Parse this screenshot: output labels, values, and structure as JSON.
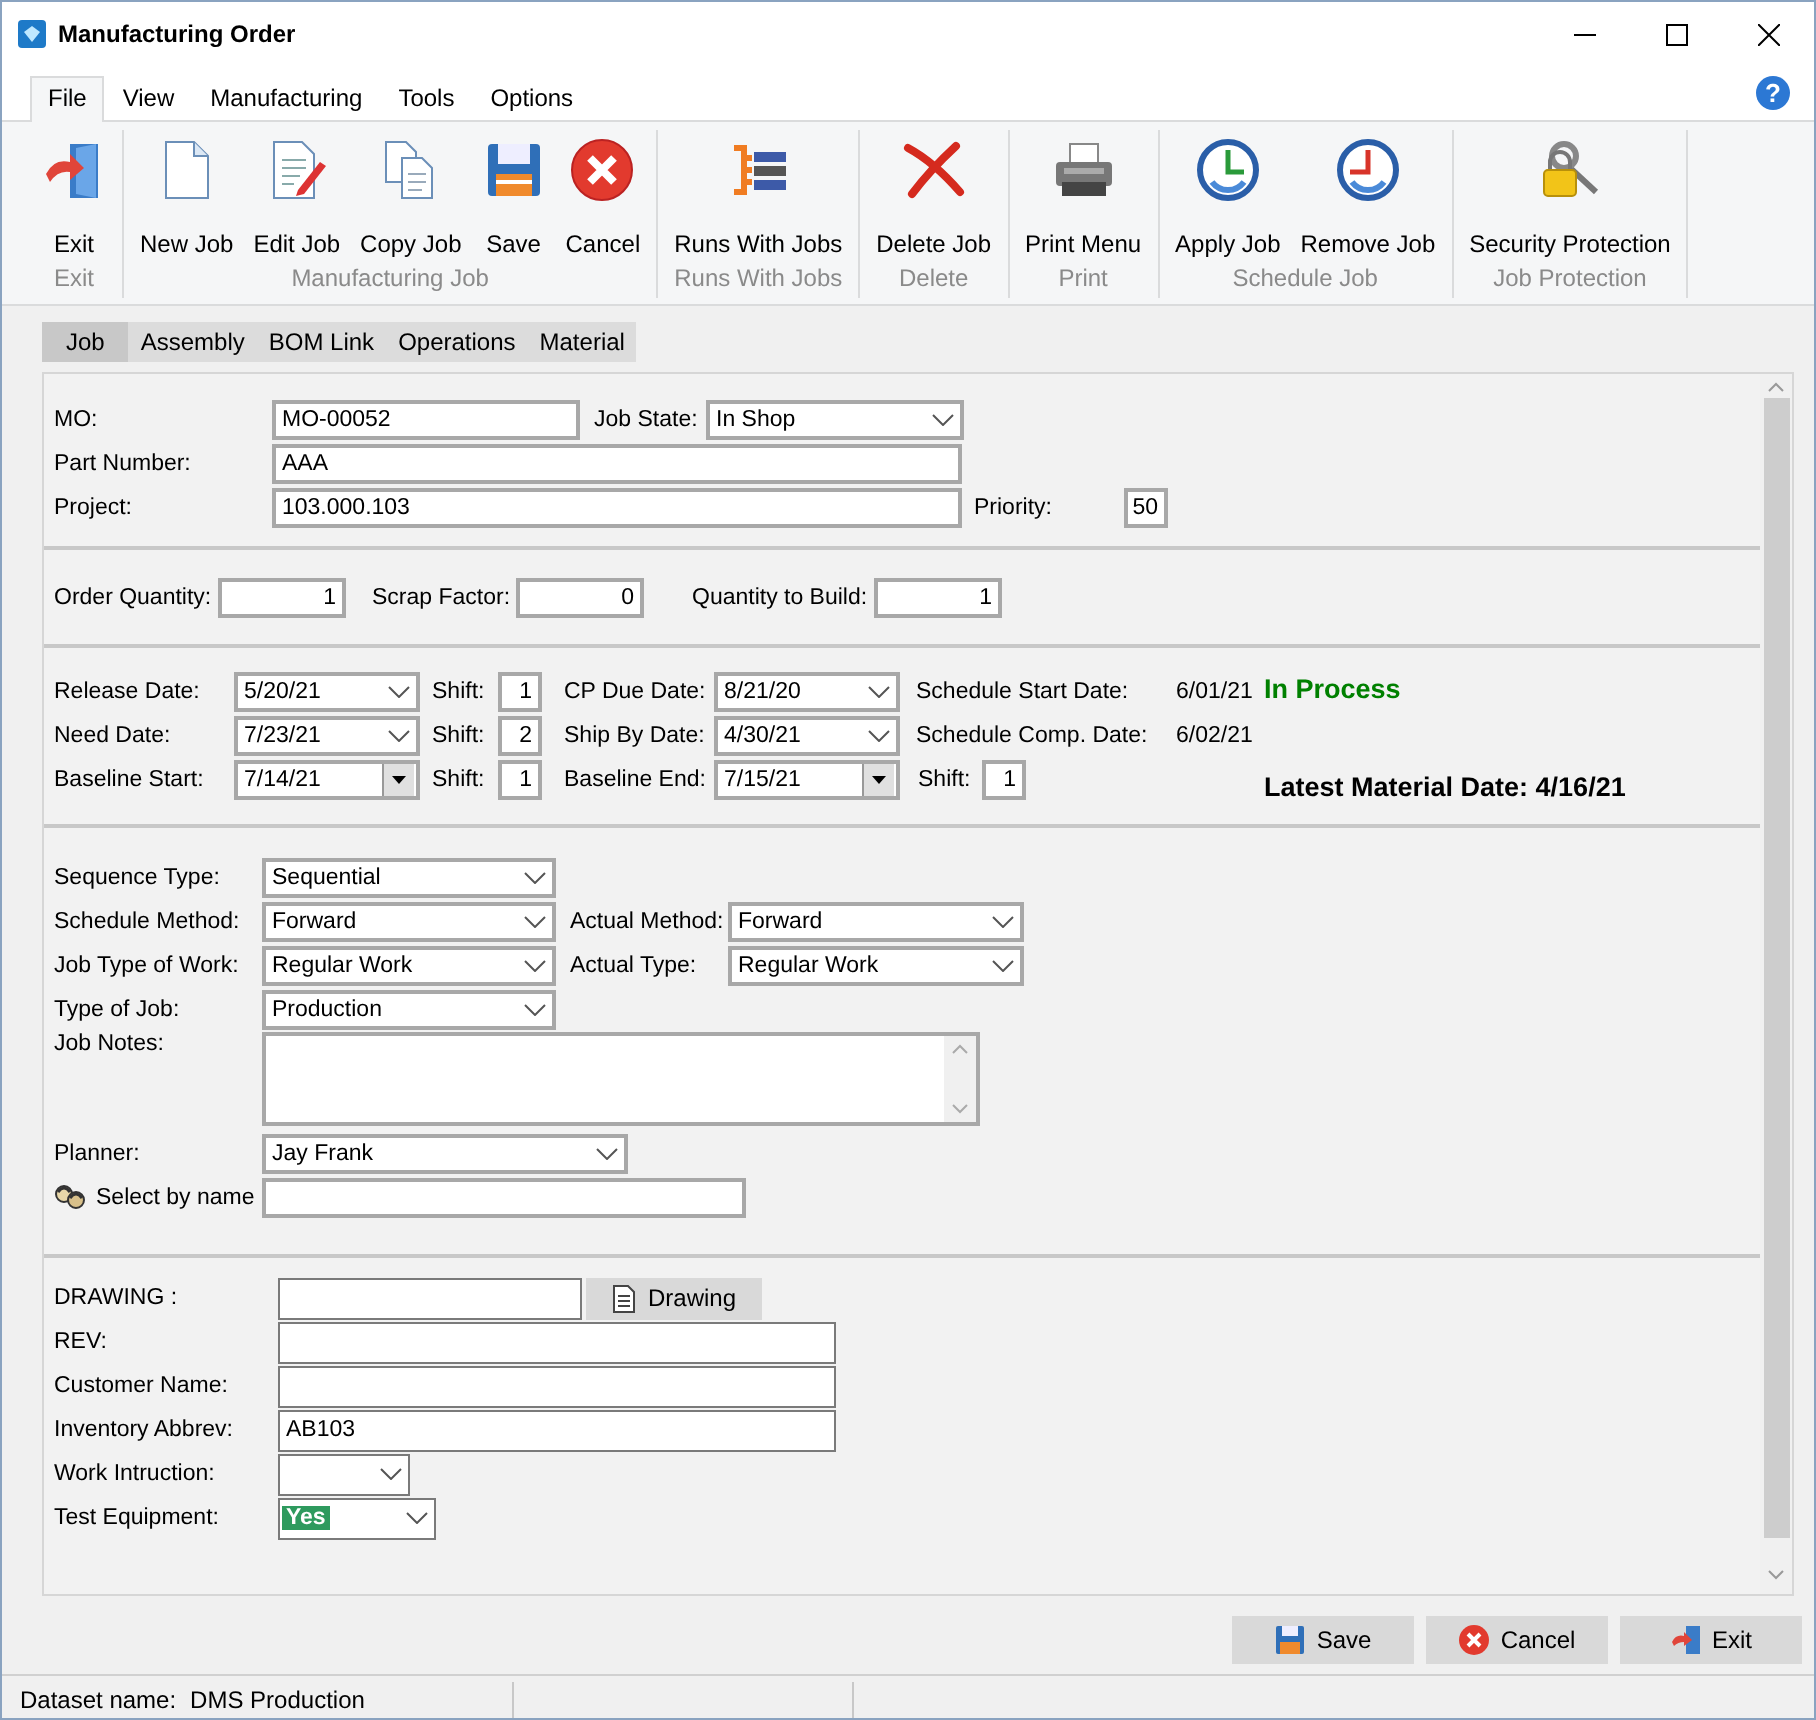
{
  "window": {
    "title": "Manufacturing Order"
  },
  "menu": [
    {
      "label": "File",
      "selected": true
    },
    {
      "label": "View",
      "selected": false
    },
    {
      "label": "Manufacturing",
      "selected": false
    },
    {
      "label": "Tools",
      "selected": false
    },
    {
      "label": "Options",
      "selected": false
    }
  ],
  "help": "?",
  "ribbon": [
    {
      "group": "Exit",
      "buttons": [
        "Exit"
      ]
    },
    {
      "group": "Manufacturing Job",
      "buttons": [
        "New Job",
        "Edit Job",
        "Copy Job",
        "Save",
        "Cancel"
      ]
    },
    {
      "group": "Runs With Jobs",
      "buttons": [
        "Runs With Jobs"
      ]
    },
    {
      "group": "Delete",
      "buttons": [
        "Delete Job"
      ]
    },
    {
      "group": "Print",
      "buttons": [
        "Print Menu"
      ]
    },
    {
      "group": "Schedule Job",
      "buttons": [
        "Apply Job",
        "Remove Job"
      ]
    },
    {
      "group": "Job Protection",
      "buttons": [
        "Security Protection"
      ]
    }
  ],
  "tabs": [
    {
      "label": "Job",
      "selected": true
    },
    {
      "label": "Assembly",
      "selected": false
    },
    {
      "label": "BOM Link",
      "selected": false
    },
    {
      "label": "Operations",
      "selected": false
    },
    {
      "label": "Material",
      "selected": false
    }
  ],
  "sections": [
    {
      "rows": [
        [
          {
            "label": "MO:",
            "kind": "text",
            "value": "MO-00052"
          },
          {
            "label": "Job State:",
            "kind": "combo",
            "value": "In Shop"
          }
        ],
        [
          {
            "label": "Part Number:",
            "kind": "text",
            "value": "AAA"
          }
        ],
        [
          {
            "label": "Project:",
            "kind": "text",
            "value": "103.000.103"
          },
          {
            "label": "Priority:",
            "kind": "number",
            "value": "50"
          }
        ]
      ]
    },
    {
      "rows": [
        [
          {
            "label": "Order Quantity:",
            "kind": "number",
            "value": "1"
          },
          {
            "label": "Scrap Factor:",
            "kind": "number",
            "value": "0"
          },
          {
            "label": "Quantity to Build:",
            "kind": "number",
            "value": "1"
          }
        ]
      ]
    },
    {
      "rows": [
        [
          {
            "label": "Release Date:",
            "kind": "combo",
            "value": "5/20/21"
          },
          {
            "label": "Shift:",
            "kind": "number",
            "value": "1"
          },
          {
            "label": "CP Due Date:",
            "kind": "combo",
            "value": "8/21/20"
          },
          {
            "label": "Schedule Start Date:",
            "kind": "readout",
            "value": "6/01/21"
          }
        ],
        [
          {
            "label": "Need Date:",
            "kind": "combo",
            "value": "7/23/21"
          },
          {
            "label": "Shift:",
            "kind": "number",
            "value": "2"
          },
          {
            "label": "Ship By Date:",
            "kind": "combo",
            "value": "4/30/21"
          },
          {
            "label": "Schedule Comp. Date:",
            "kind": "readout",
            "value": "6/02/21"
          }
        ],
        [
          {
            "label": "Baseline Start:",
            "kind": "picker",
            "value": "7/14/21"
          },
          {
            "label": "Shift:",
            "kind": "number",
            "value": "1"
          },
          {
            "label": "Baseline End:",
            "kind": "picker",
            "value": "7/15/21"
          },
          {
            "label": "Shift:",
            "kind": "number",
            "value": "1"
          }
        ]
      ],
      "notes": [
        {
          "text": "In Process",
          "color": "#008000"
        },
        {
          "text": "Latest Material Date: 4/16/21",
          "color": "#000000"
        }
      ]
    },
    {
      "rows": [
        [
          {
            "label": "Sequence Type:",
            "kind": "combo",
            "value": "Sequential"
          }
        ],
        [
          {
            "label": "Schedule Method:",
            "kind": "combo",
            "value": "Forward"
          },
          {
            "label": "Actual Method:",
            "kind": "combo",
            "value": "Forward"
          }
        ],
        [
          {
            "label": "Job Type of Work:",
            "kind": "combo",
            "value": "Regular Work"
          },
          {
            "label": "Actual Type:",
            "kind": "combo",
            "value": "Regular Work"
          }
        ],
        [
          {
            "label": "Type of Job:",
            "kind": "combo",
            "value": "Production"
          }
        ],
        [
          {
            "label": "Job Notes:",
            "kind": "memo"
          }
        ],
        [
          {
            "label": "Planner:",
            "kind": "combo",
            "value": "Jay Frank"
          }
        ],
        [
          {
            "label": "Select by name",
            "kind": "name-search"
          }
        ]
      ]
    },
    {
      "rows": [
        [
          {
            "label": "DRAWING :",
            "kind": "text"
          },
          {
            "label": "Drawing",
            "kind": "button"
          }
        ],
        [
          {
            "label": "REV:",
            "kind": "text"
          }
        ],
        [
          {
            "label": "Customer Name:",
            "kind": "text"
          }
        ],
        [
          {
            "label": "Inventory Abbrev:",
            "kind": "text",
            "value": "AB103"
          }
        ],
        [
          {
            "label": "Work Intruction:",
            "kind": "combo"
          }
        ],
        [
          {
            "label": "Test Equipment:",
            "kind": "focused-combo",
            "value": "Yes"
          }
        ]
      ]
    }
  ],
  "footer_buttons": [
    "Save",
    "Cancel",
    "Exit"
  ],
  "status_bar": {
    "label": "Dataset name:",
    "value": "DMS Production"
  }
}
